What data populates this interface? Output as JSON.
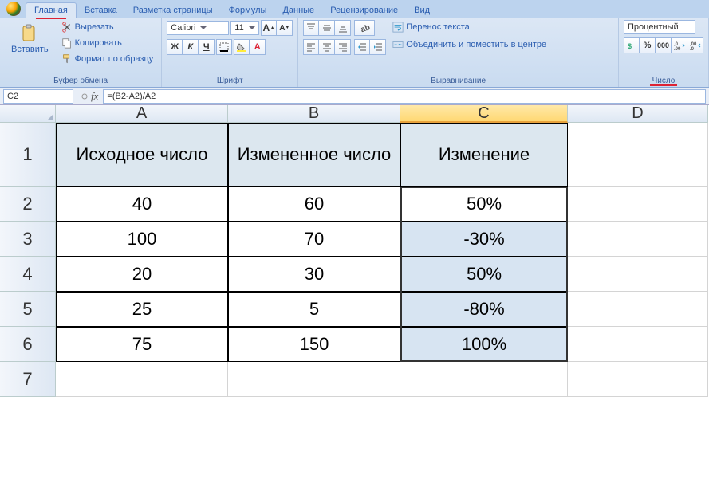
{
  "tabs": [
    "Главная",
    "Вставка",
    "Разметка страницы",
    "Формулы",
    "Данные",
    "Рецензирование",
    "Вид"
  ],
  "active_tab": 0,
  "clipboard": {
    "paste": "Вставить",
    "cut": "Вырезать",
    "copy": "Копировать",
    "format_painter": "Формат по образцу",
    "group": "Буфер обмена"
  },
  "font": {
    "name": "Calibri",
    "size": "11",
    "group": "Шрифт",
    "bold": "Ж",
    "italic": "К",
    "underline": "Ч"
  },
  "alignment": {
    "wrap": "Перенос текста",
    "merge": "Объединить и поместить в центре",
    "group": "Выравнивание"
  },
  "number": {
    "format": "Процентный",
    "group": "Число"
  },
  "cell_ref": "C2",
  "formula": "=(B2-A2)/A2",
  "columns": [
    "A",
    "B",
    "C",
    "D"
  ],
  "selected_col": "C",
  "headers": {
    "A": "Исходное число",
    "B": "Измененное число",
    "C": "Изменение"
  },
  "rows": [
    {
      "n": "2",
      "A": "40",
      "B": "60",
      "C": "50%"
    },
    {
      "n": "3",
      "A": "100",
      "B": "70",
      "C": "-30%"
    },
    {
      "n": "4",
      "A": "20",
      "B": "30",
      "C": "50%"
    },
    {
      "n": "5",
      "A": "25",
      "B": "5",
      "C": "-80%"
    },
    {
      "n": "6",
      "A": "75",
      "B": "150",
      "C": "100%"
    }
  ]
}
